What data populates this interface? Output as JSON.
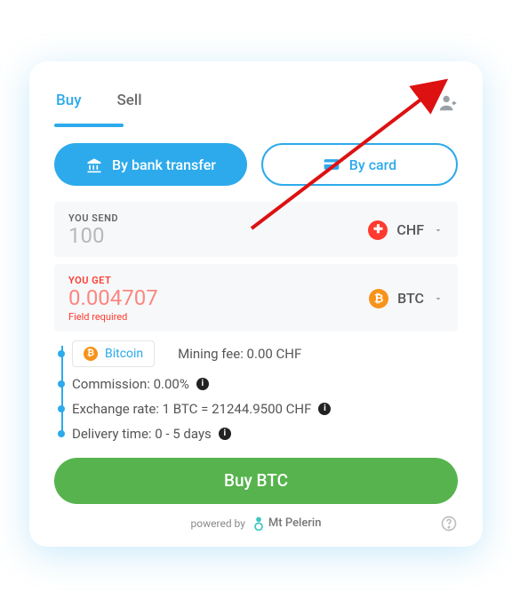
{
  "tabs": {
    "buy": "Buy",
    "sell": "Sell",
    "active": "buy"
  },
  "payment": {
    "bank": "By bank transfer",
    "card": "By card"
  },
  "send": {
    "label": "YOU SEND",
    "value": "100",
    "currency": "CHF"
  },
  "get": {
    "label": "YOU GET",
    "value": "0.004707",
    "currency": "BTC",
    "error": "Field required"
  },
  "network": {
    "name": "Bitcoin"
  },
  "mining_fee": "Mining fee: 0.00 CHF",
  "commission": "Commission: 0.00%",
  "rate": "Exchange rate: 1 BTC = 21244.9500 CHF",
  "delivery": "Delivery time: 0 - 5 days",
  "cta": "Buy BTC",
  "powered_by": "powered by",
  "brand": "Mt Pelerin"
}
